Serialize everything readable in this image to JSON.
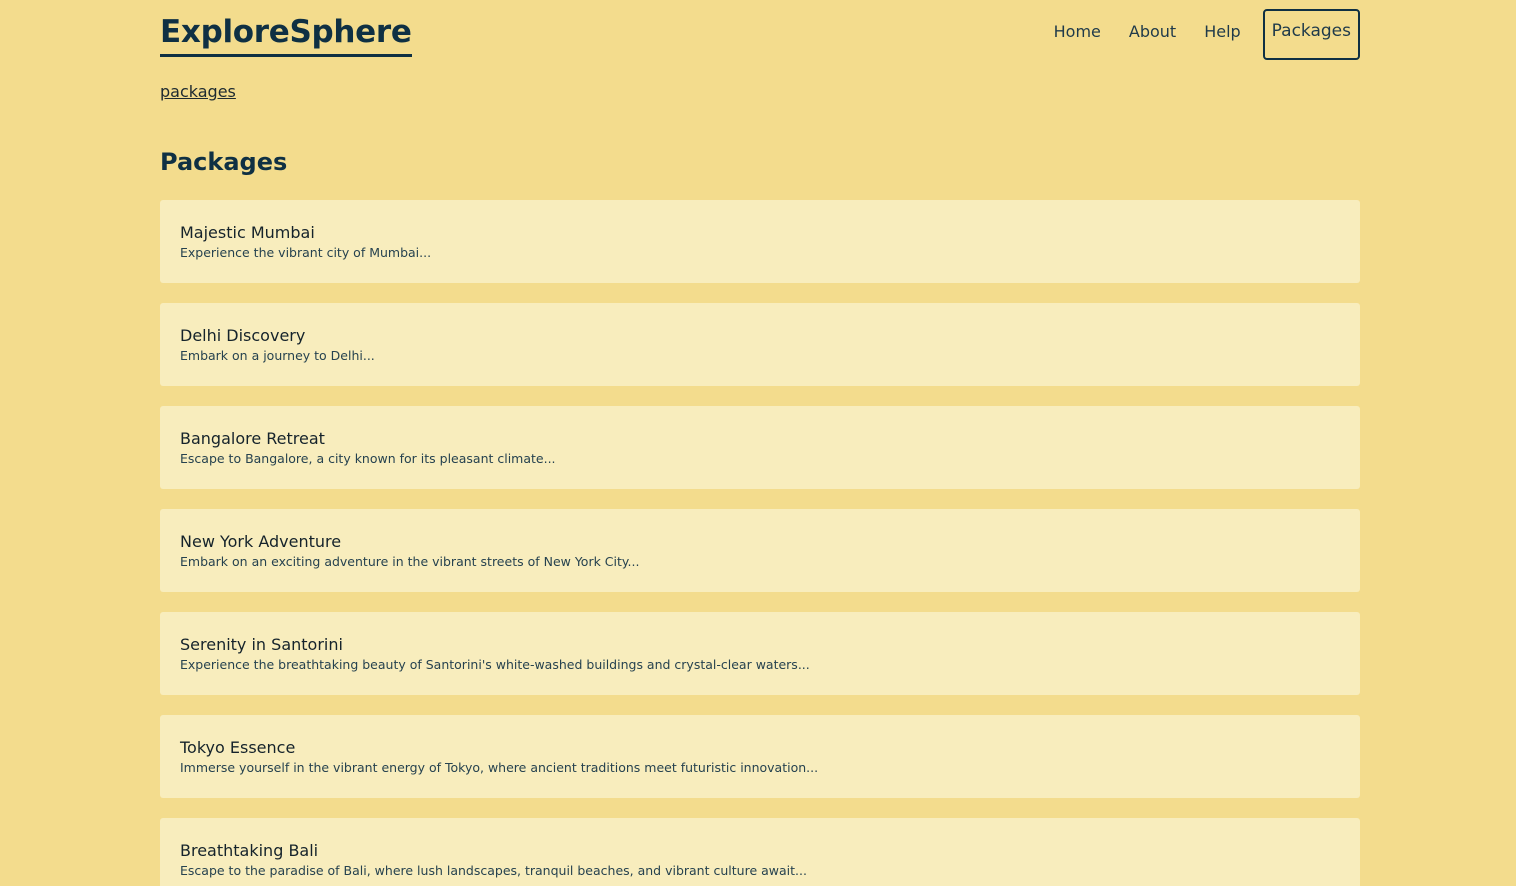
{
  "header": {
    "logo": "ExploreSphere",
    "nav": [
      {
        "label": "Home"
      },
      {
        "label": "About"
      },
      {
        "label": "Help"
      },
      {
        "label": "Packages"
      }
    ]
  },
  "breadcrumb": "packages",
  "page_title": "Packages",
  "packages": [
    {
      "title": "Majestic Mumbai",
      "description": "Experience the vibrant city of Mumbai..."
    },
    {
      "title": "Delhi Discovery",
      "description": "Embark on a journey to Delhi..."
    },
    {
      "title": "Bangalore Retreat",
      "description": "Escape to Bangalore, a city known for its pleasant climate..."
    },
    {
      "title": "New York Adventure",
      "description": "Embark on an exciting adventure in the vibrant streets of New York City..."
    },
    {
      "title": "Serenity in Santorini",
      "description": "Experience the breathtaking beauty of Santorini's white-washed buildings and crystal-clear waters..."
    },
    {
      "title": "Tokyo Essence",
      "description": "Immerse yourself in the vibrant energy of Tokyo, where ancient traditions meet futuristic innovation..."
    },
    {
      "title": "Breathtaking Bali",
      "description": "Escape to the paradise of Bali, where lush landscapes, tranquil beaches, and vibrant culture await..."
    }
  ],
  "colors": {
    "background": "#f3dc8d",
    "card": "#f8edbd",
    "accent": "#0f3043"
  }
}
